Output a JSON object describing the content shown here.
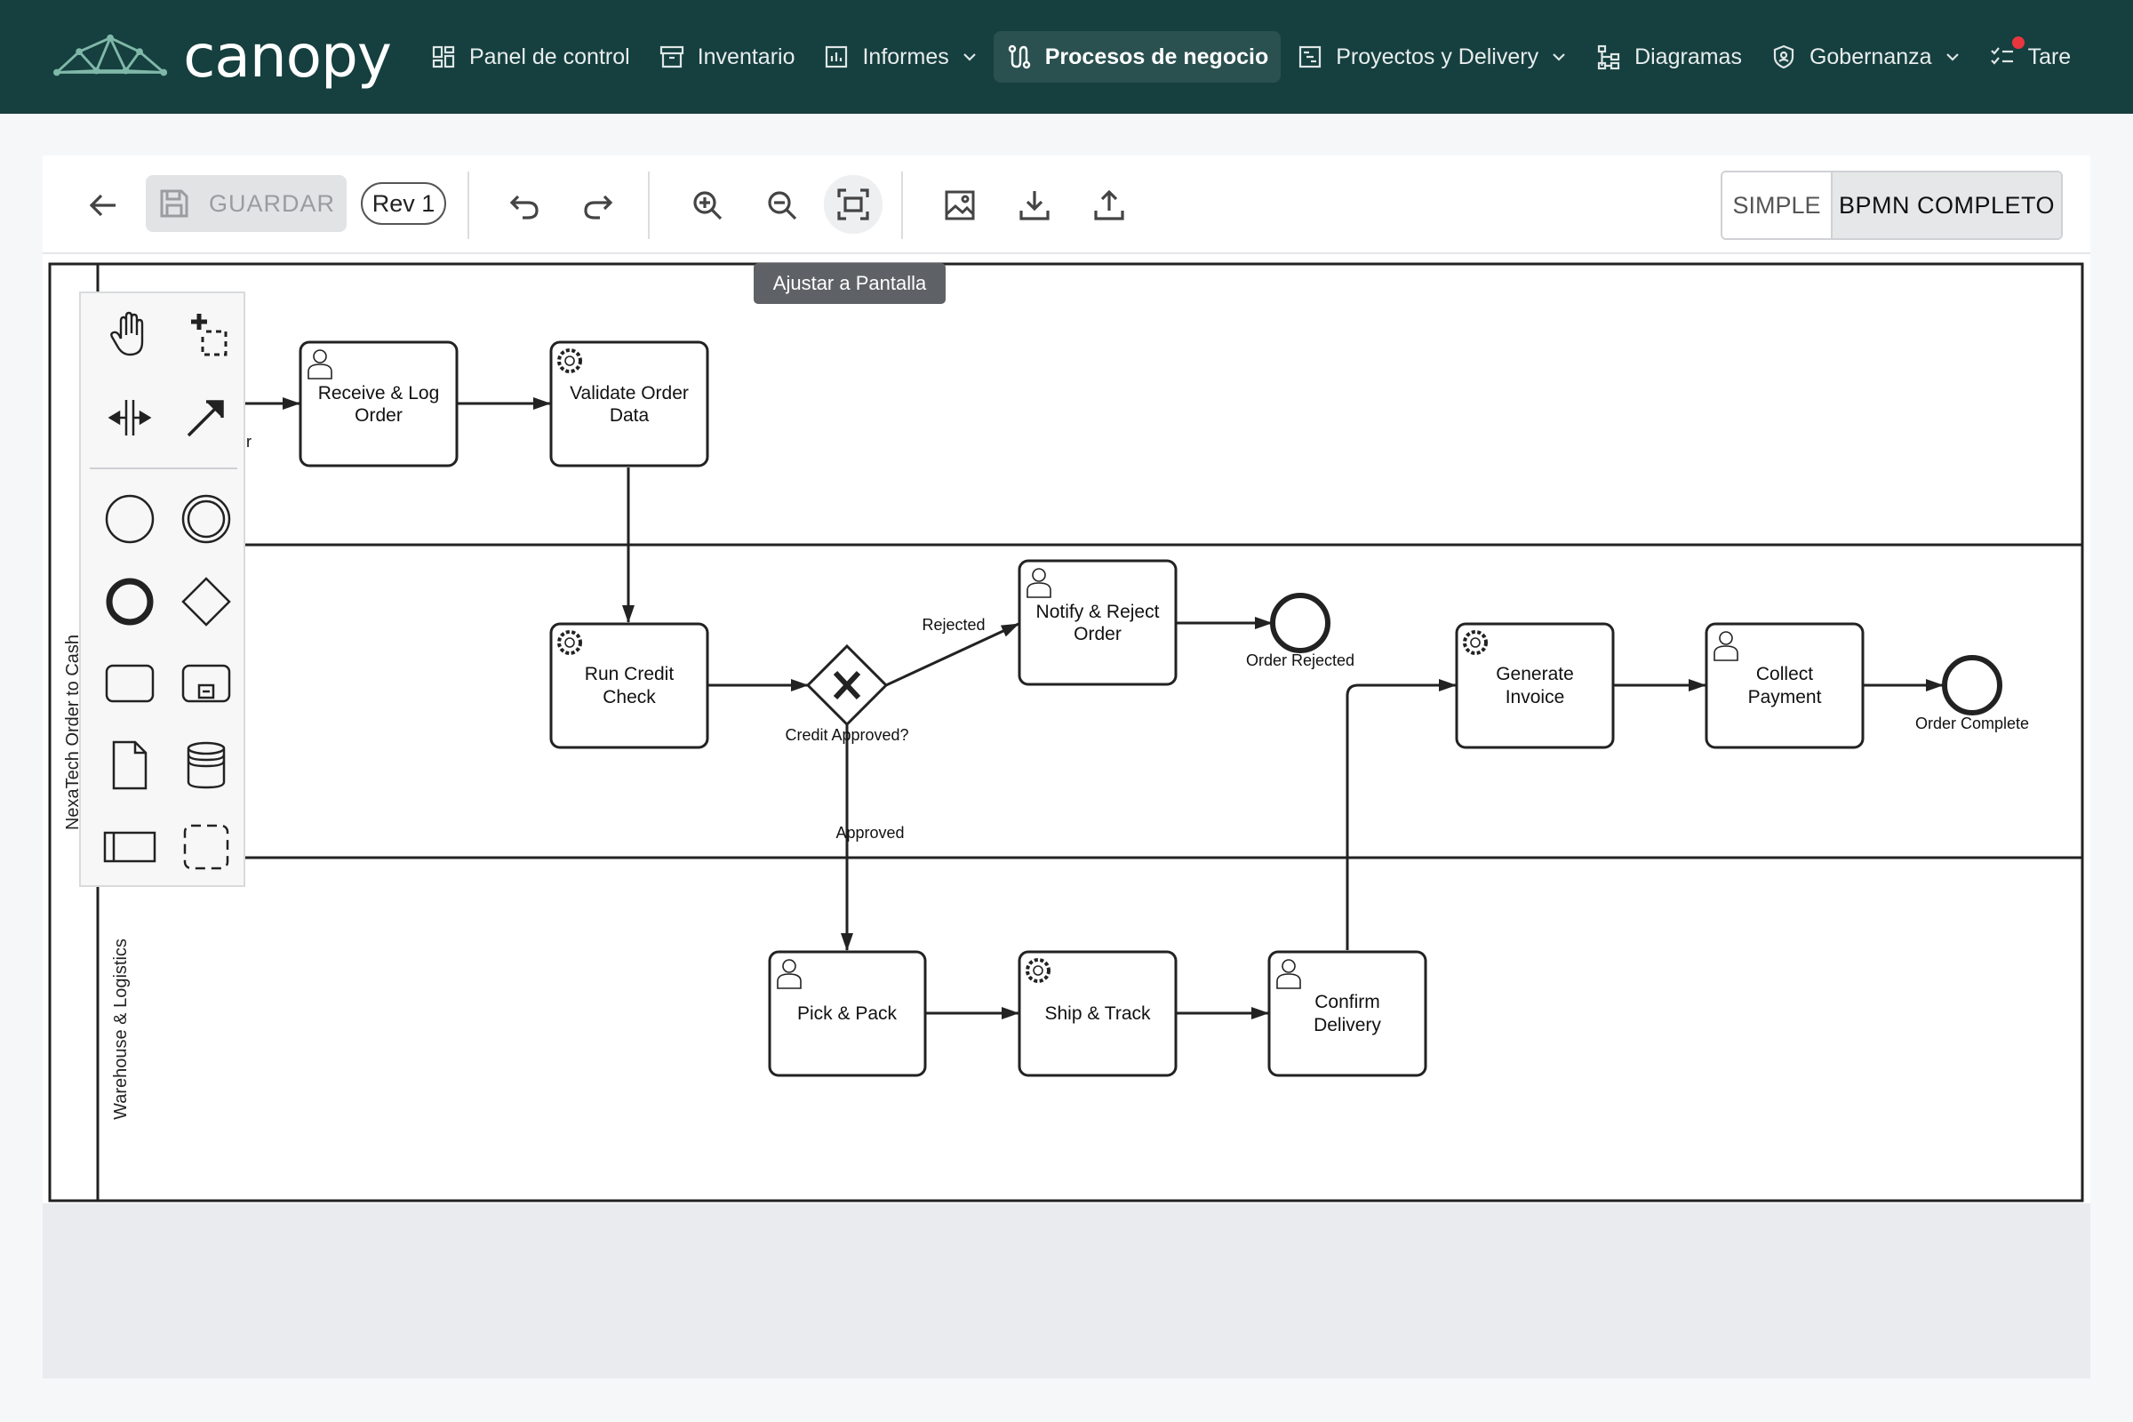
{
  "app": {
    "brand": "canopy"
  },
  "colors": {
    "topbar": "#163f3f",
    "active_nav": "#2b5050",
    "notification_dot": "#e8363e",
    "tooltip": "#5e6266"
  },
  "nav": {
    "items": [
      {
        "label": "Panel de control",
        "icon": "dashboard-icon"
      },
      {
        "label": "Inventario",
        "icon": "archive-icon"
      },
      {
        "label": "Informes",
        "icon": "bar-chart-icon",
        "dropdown": true
      },
      {
        "label": "Procesos de negocio",
        "icon": "workflow-icon",
        "active": true
      },
      {
        "label": "Proyectos y Delivery",
        "icon": "gantt-icon",
        "dropdown": true
      },
      {
        "label": "Diagramas",
        "icon": "hierarchy-icon"
      },
      {
        "label": "Gobernanza",
        "icon": "shield-icon",
        "dropdown": true
      },
      {
        "label": "Tare",
        "icon": "tasks-icon",
        "notification": true
      }
    ]
  },
  "toolbar": {
    "back_icon": "arrow-left-icon",
    "save_label": "GUARDAR",
    "save_disabled": true,
    "revision": "Rev 1",
    "undo_icon": "undo-icon",
    "redo_icon": "redo-icon",
    "zoom_in_icon": "zoom-in-icon",
    "zoom_out_icon": "zoom-out-icon",
    "fit_icon": "fit-screen-icon",
    "image_icon": "image-icon",
    "download_icon": "download-icon",
    "upload_icon": "upload-icon",
    "mode_simple": "SIMPLE",
    "mode_full": "BPMN COMPLETO",
    "selected_mode": "BPMN COMPLETO"
  },
  "tooltip": "Ajustar a Pantalla",
  "palette": {
    "tools": [
      "hand-tool-icon",
      "lasso-select-icon",
      "space-tool-icon",
      "connect-arrow-icon"
    ],
    "shapes": [
      "start-event-icon",
      "intermediate-event-icon",
      "end-event-icon",
      "gateway-icon",
      "task-icon",
      "subprocess-icon",
      "data-object-icon",
      "data-store-icon",
      "pool-icon",
      "group-icon"
    ]
  },
  "diagram": {
    "pool_label": "NexaTech Order to Cash",
    "lane_label": "Warehouse & Logistics",
    "cut_off_start_label": "r",
    "tasks": [
      {
        "id": "t1",
        "label_lines": [
          "Receive & Log",
          "Order"
        ],
        "kind": "user"
      },
      {
        "id": "t2",
        "label_lines": [
          "Validate Order",
          "Data"
        ],
        "kind": "service"
      },
      {
        "id": "t3",
        "label_lines": [
          "Run Credit",
          "Check"
        ],
        "kind": "service"
      },
      {
        "id": "t4",
        "label_lines": [
          "Notify & Reject",
          "Order"
        ],
        "kind": "user"
      },
      {
        "id": "t5",
        "label_lines": [
          "Generate",
          "Invoice"
        ],
        "kind": "service"
      },
      {
        "id": "t6",
        "label_lines": [
          "Collect",
          "Payment"
        ],
        "kind": "user"
      },
      {
        "id": "t7",
        "label_lines": [
          "Pick & Pack"
        ],
        "kind": "user"
      },
      {
        "id": "t8",
        "label_lines": [
          "Ship & Track"
        ],
        "kind": "service"
      },
      {
        "id": "t9",
        "label_lines": [
          "Confirm",
          "Delivery"
        ],
        "kind": "user"
      }
    ],
    "gateway": {
      "label": "Credit Approved?",
      "kind": "exclusive"
    },
    "end_events": [
      {
        "id": "e1",
        "label": "Order Rejected"
      },
      {
        "id": "e2",
        "label": "Order Complete"
      }
    ],
    "flow_labels": {
      "rejected": "Rejected",
      "approved": "Approved"
    }
  }
}
